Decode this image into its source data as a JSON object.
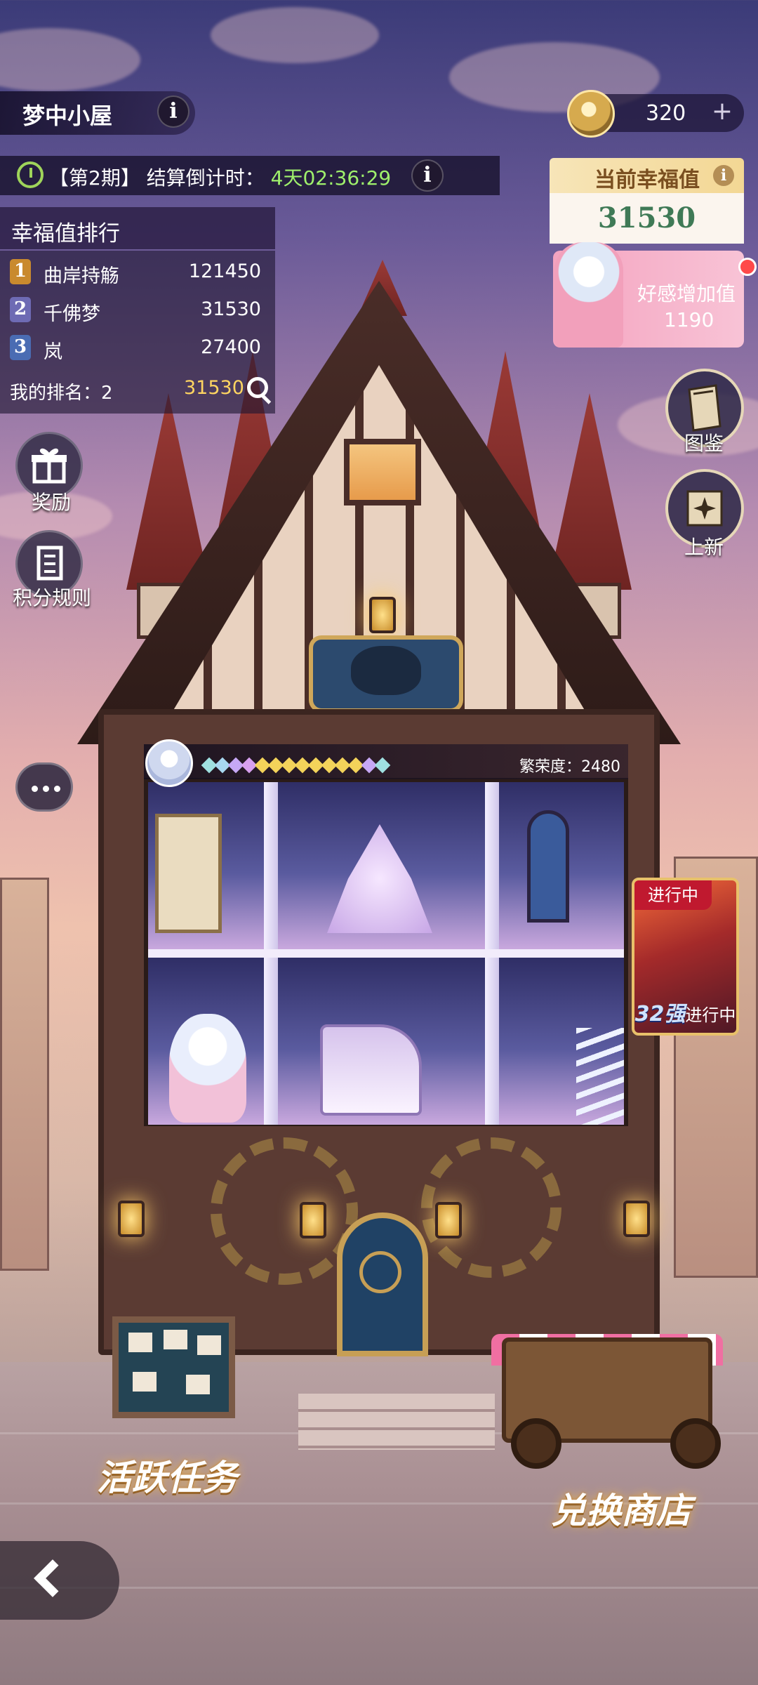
{
  "header": {
    "title": "梦中小屋",
    "info_icon": "i"
  },
  "currency": {
    "value": "320",
    "plus": "+",
    "icon": "star-coin-icon"
  },
  "countdown": {
    "period": "【第2期】",
    "label": "结算倒计时：",
    "time": "4天02:36:29",
    "info_icon": "i"
  },
  "ranking": {
    "title": "幸福值排行",
    "rows": [
      {
        "rank": "1",
        "name": "曲岸持觞",
        "score": "121450",
        "color": "#c98a2e"
      },
      {
        "rank": "2",
        "name": "千佛梦",
        "score": "31530",
        "color": "#6e6bb4"
      },
      {
        "rank": "3",
        "name": "岚",
        "score": "27400",
        "color": "#4a6cb3"
      }
    ],
    "my_rank_label": "我的排名：2",
    "my_score": "31530"
  },
  "left_buttons": {
    "reward": "奖励",
    "rules": "积分规则"
  },
  "happiness": {
    "title": "当前幸福值",
    "value": "31530",
    "info_icon": "i"
  },
  "favor": {
    "label": "好感增加值",
    "value": "1190"
  },
  "right_buttons": {
    "gallery": "图鉴",
    "new": "上新"
  },
  "rooms": {
    "prosperity": "繁荣度：2480",
    "gem_colors": [
      "#9fe0e0",
      "#a8d8f0",
      "#c6a8f5",
      "#d7a0ef",
      "#f3d35a",
      "#f3d35a",
      "#f3d35a",
      "#f3d35a",
      "#f3d35a",
      "#f3d35a",
      "#f3d35a",
      "#f3d35a",
      "#c6a8f5",
      "#9fe0e0"
    ]
  },
  "event": {
    "tag": "进行中",
    "big": "32强",
    "status": "进行中"
  },
  "bottom": {
    "tasks": "活跃任务",
    "shop": "兑换商店"
  },
  "colors": {
    "accent_gold": "#f3d794",
    "happiness_green": "#3f7a56",
    "score_yellow": "#ffd561",
    "timer_green": "#9ff06c"
  }
}
